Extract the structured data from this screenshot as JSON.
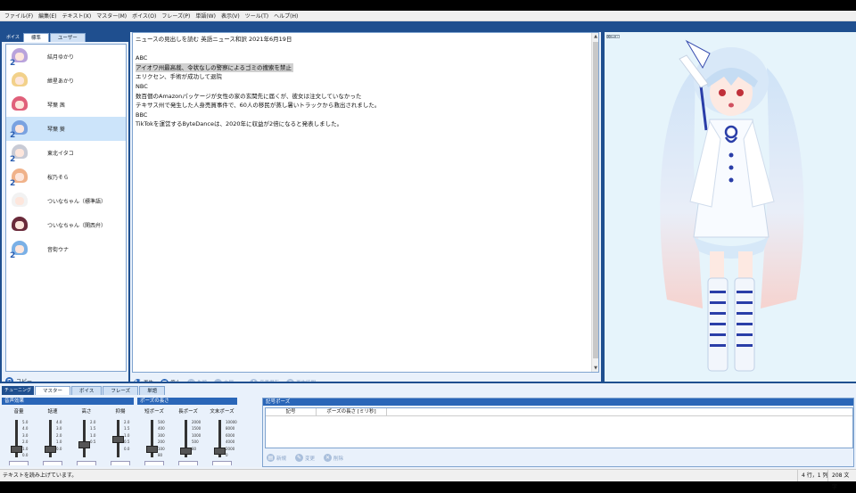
{
  "menu": [
    "ファイル(F)",
    "編集(E)",
    "テキスト(X)",
    "マスター(M)",
    "ボイス(O)",
    "フレーズ(P)",
    "単語(W)",
    "表示(V)",
    "ツール(T)",
    "ヘルプ(H)"
  ],
  "left_panel": {
    "label": "ボイス",
    "tabs": [
      "標準",
      "ユーザー"
    ],
    "voices": [
      {
        "name": "結月ゆかり",
        "hair": "#b9a3dc",
        "badge": "2"
      },
      {
        "name": "紲星あかり",
        "hair": "#f2d18a",
        "badge": ""
      },
      {
        "name": "琴葉 茜",
        "hair": "#e0607a",
        "badge": ""
      },
      {
        "name": "琴葉 葵",
        "hair": "#7aa2e0",
        "badge": "2"
      },
      {
        "name": "東北イタコ",
        "hair": "#c8cbd6",
        "badge": "2"
      },
      {
        "name": "桜乃そら",
        "hair": "#f0b28a",
        "badge": "2"
      },
      {
        "name": "ついなちゃん（標準語）",
        "hair": "#f2f2f2",
        "badge": ""
      },
      {
        "name": "ついなちゃん（関西弁）",
        "hair": "#6a2a3a",
        "badge": ""
      },
      {
        "name": "音街ウナ",
        "hair": "#7ab0e6",
        "badge": "2"
      }
    ],
    "copy_label": "コピー"
  },
  "editor": {
    "lines": [
      "ニュースの見出しを読む 英語ニュース和訳 2021年6月19日",
      "",
      "ABC",
      "アイオワ州最高裁、令状なしの警察によるゴミの捜索を禁止",
      "エリクセン、手術が成功して退院",
      "NBC",
      "数百個のAmazonパッケージが女性の家の玄関先に届くが、彼女は注文していなかった",
      "テキサス州で発生した人身売買事件で、60人の移民が蒸し暑いトラックから救出されました。",
      "BBC",
      "TikTokを運営するByteDanceは、2020年に収益が2倍になると発表しました。"
    ],
    "highlighted_line": 3
  },
  "playbar": {
    "play": "再生",
    "stop": "停止",
    "prev": "先頭",
    "next": "末尾",
    "save": "音声保存",
    "time": "再生時間"
  },
  "char_toolbar": "⊠⊟⊡",
  "bottom": {
    "label": "チューニング",
    "tabs": [
      "マスター",
      "ボイス",
      "フレーズ",
      "単語"
    ],
    "effect_title": "音声効果",
    "pause_title": "ポーズの長さ",
    "effect_sliders": [
      {
        "label": "音量",
        "ticks": [
          "5.0",
          "4.0",
          "3.0",
          "2.0",
          "1.0",
          "0.0"
        ],
        "knob_frac": 0.8
      },
      {
        "label": "話速",
        "ticks": [
          "4.0",
          "3.0",
          "2.0",
          "1.0",
          "0.0"
        ],
        "knob_frac": 0.8
      },
      {
        "label": "高さ",
        "ticks": [
          "2.0",
          "1.5",
          "1.0",
          "0.5"
        ],
        "knob_frac": 0.67
      },
      {
        "label": "抑揚",
        "ticks": [
          "2.0",
          "1.5",
          "1.0",
          "0.5",
          "0.0"
        ],
        "knob_frac": 0.5
      }
    ],
    "pause_sliders": [
      {
        "label": "短ポーズ",
        "ticks": [
          "500",
          "400",
          "300",
          "200",
          "100",
          "80"
        ],
        "knob_frac": 0.8
      },
      {
        "label": "長ポーズ",
        "ticks": [
          "2000",
          "1500",
          "1000",
          "500",
          "80"
        ],
        "knob_frac": 0.85
      },
      {
        "label": "文末ポーズ",
        "ticks": [
          "10000",
          "8000",
          "6000",
          "4000",
          "2000",
          "0"
        ],
        "knob_frac": 0.85
      }
    ],
    "kigo": {
      "title": "記号ポーズ",
      "col1": "記号",
      "col2": "ポーズの長さ [ミリ秒]",
      "new": "新規",
      "edit": "変更",
      "delete": "削除"
    }
  },
  "status": {
    "left": "テキストを読み上げています。",
    "position": "4 行，1 列",
    "chars": "208 文字"
  }
}
